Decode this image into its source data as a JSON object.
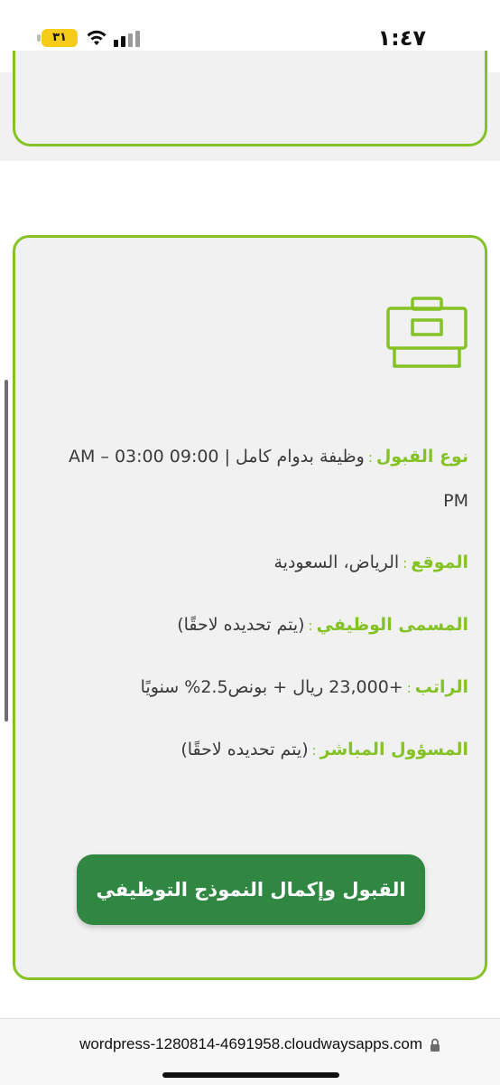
{
  "status_bar": {
    "time": "١:٤٧",
    "battery_level": "٣١"
  },
  "colors": {
    "accent": "#84c225",
    "button": "#2f8742",
    "card_bg": "#f1f1f1"
  },
  "card": {
    "icon": "briefcase-icon",
    "rows": [
      {
        "label": "نوع القبول",
        "value": "وظيفة بدوام كامل | 09:00 03:00 – AM PM"
      },
      {
        "label": "الموقع",
        "value": "الرياض، السعودية"
      },
      {
        "label": "المسمى الوظيفي",
        "value": "(يتم تحديده لاحقًا)"
      },
      {
        "label": "الراتب",
        "value": "+23,000 ريال + بونص2.5% سنويًا"
      },
      {
        "label": "المسؤول المباشر",
        "value": "(يتم تحديده لاحقًا)"
      }
    ],
    "button_label": "القبول وإكمال النموذج التوظيفي"
  },
  "browser": {
    "url": "wordpress-1280814-4691958.cloudwaysapps.com"
  }
}
